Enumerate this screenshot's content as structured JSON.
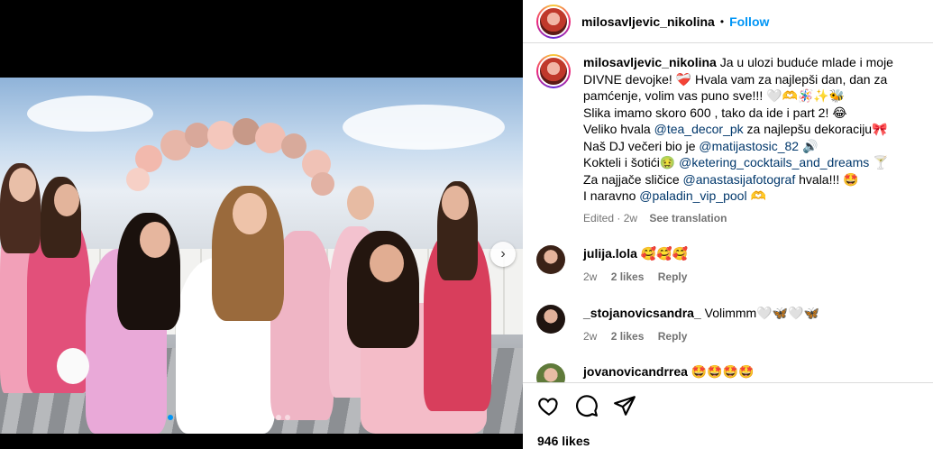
{
  "post": {
    "author": "milosavljevic_nikolina",
    "separator": "•",
    "follow_label": "Follow",
    "carousel": {
      "total_slides": 14,
      "active_slide": 1
    }
  },
  "caption": {
    "author": "milosavljevic_nikolina",
    "line1": "Ja u ulozi buduće mlade i moje DIVNE devojke! ❤️‍🩹 Hvala vam za najlepši dan, dan za pamćenje, volim vas puno sve!!! 🤍🫶🪅✨🐝",
    "line2": "Slika imamo skoro 600 , tako da ide i part 2! 😂",
    "line3_pre": "Veliko hvala ",
    "line3_link": "@tea_decor_pk",
    "line3_post": " za najlepšu dekoraciju🎀",
    "line4_pre": "Naš DJ večeri bio je ",
    "line4_link": "@matijastosic_82",
    "line4_post": " 🔊",
    "line5_pre": "Kokteli i šotići🤢 ",
    "line5_link": "@ketering_cocktails_and_dreams",
    "line5_post": " 🍸",
    "line6_pre": "Za najjače sličice ",
    "line6_link": "@anastasijafotograf",
    "line6_post": " hvala!!! 🤩",
    "line7_pre": "I naravno ",
    "line7_link": "@paladin_vip_pool",
    "line7_post": " 🫶",
    "edited": "Edited · 2w",
    "see_translation": "See translation"
  },
  "comments": [
    {
      "user": "julija.lola",
      "text": "🥰🥰🥰",
      "age": "2w",
      "likes": "2 likes",
      "reply": "Reply"
    },
    {
      "user": "_stojanovicsandra_",
      "text": "Volimmm🤍🦋🤍🦋",
      "age": "2w",
      "likes": "2 likes",
      "reply": "Reply"
    },
    {
      "user": "jovanovicandrrea",
      "text": "🤩🤩🤩🤩",
      "age": "",
      "likes": "",
      "reply": ""
    }
  ],
  "footer": {
    "likes": "946 likes"
  },
  "colors": {
    "accent": "#0095f6",
    "link": "#00376b",
    "muted": "#737373",
    "border": "#dbdbdb"
  }
}
